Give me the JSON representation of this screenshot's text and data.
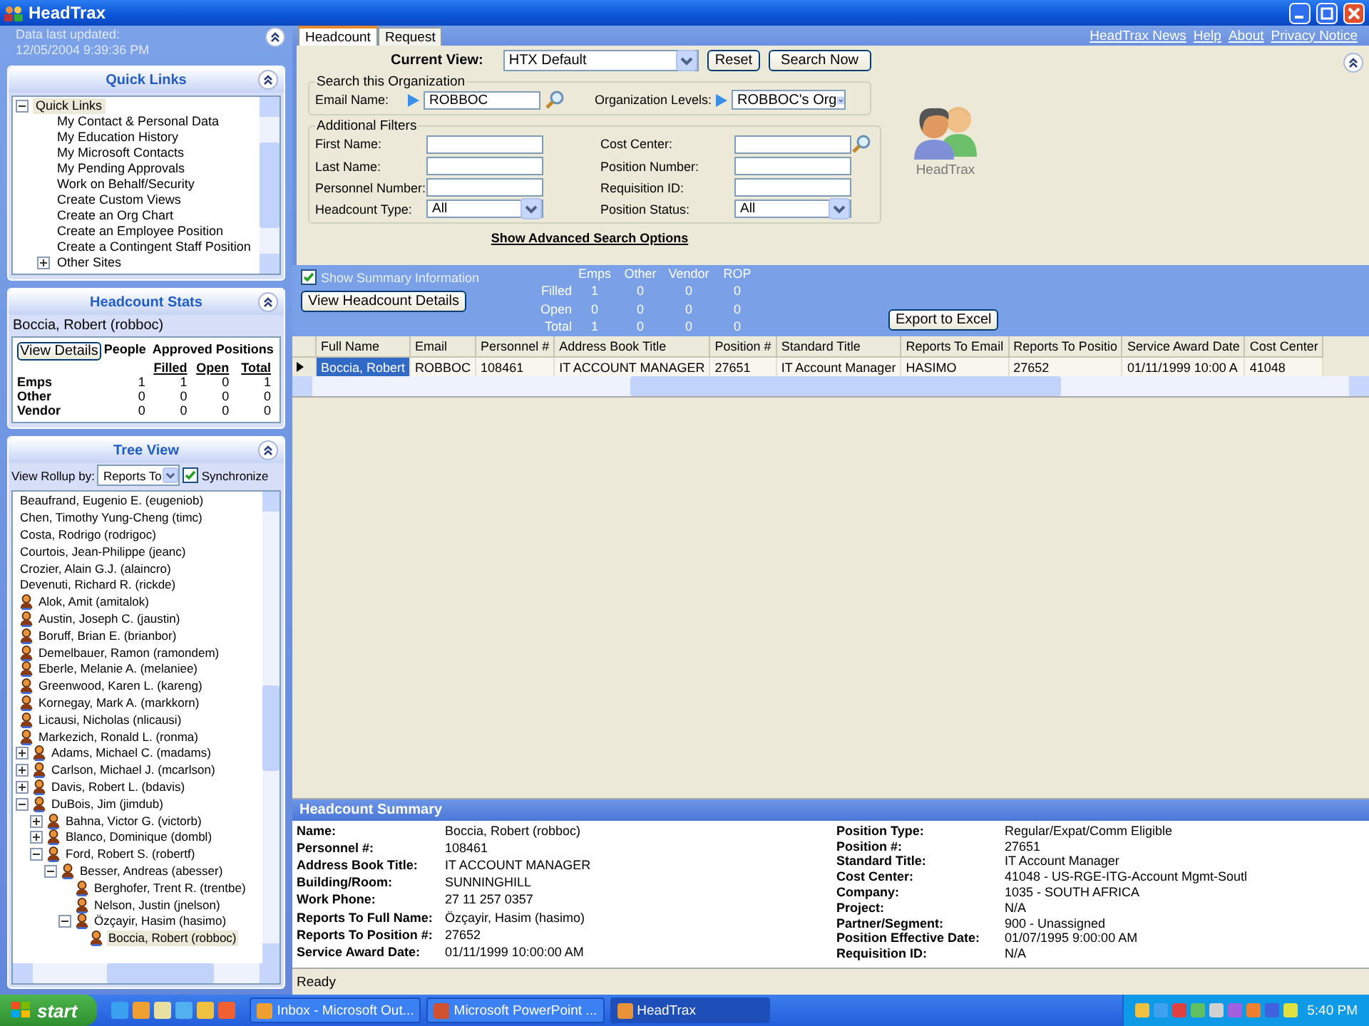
{
  "window": {
    "title": "HeadTrax"
  },
  "sidebar": {
    "updated_label": "Data last updated:",
    "updated_value": "12/05/2004 9:39:36 PM",
    "quick_links": {
      "title": "Quick Links",
      "items": [
        {
          "label": "Quick Links",
          "expanded": true,
          "selected": true,
          "children": [
            {
              "label": "My Contact & Personal Data",
              "selected": false
            },
            {
              "label": "My Education History",
              "selected": false
            },
            {
              "label": "My Microsoft Contacts",
              "selected": false
            },
            {
              "label": "My Pending Approvals",
              "selected": false
            },
            {
              "label": "Work on Behalf/Security",
              "selected": false
            },
            {
              "label": "Create Custom Views",
              "selected": false
            },
            {
              "label": "Create an Org Chart",
              "selected": false
            },
            {
              "label": "Create an Employee Position",
              "selected": false
            },
            {
              "label": "Create a Contingent Staff Position",
              "selected": false
            },
            {
              "label": "Other Sites",
              "expanded": false,
              "selected": false
            }
          ]
        }
      ]
    },
    "headcount_stats": {
      "title": "Headcount Stats",
      "person": "Boccia, Robert (robboc)",
      "button": "View Details",
      "people_header": "People",
      "positions_header": "Approved Positions",
      "columns": [
        "Filled",
        "Open",
        "Total"
      ],
      "rows": [
        {
          "label": "Emps",
          "people": "1",
          "values": [
            "1",
            "0",
            "1"
          ]
        },
        {
          "label": "Other",
          "people": "0",
          "values": [
            "0",
            "0",
            "0"
          ]
        },
        {
          "label": "Vendor",
          "people": "0",
          "values": [
            "0",
            "0",
            "0"
          ]
        }
      ]
    },
    "tree_view": {
      "title": "Tree View",
      "rollup_label": "View Rollup by:",
      "rollup_value": "Reports To",
      "synchronize": {
        "label": "Synchronize",
        "checked": true
      },
      "items": [
        {
          "label": "Beaufrand, Eugenio E. (eugeniob)",
          "kind": "plain",
          "selected": false
        },
        {
          "label": "Chen, Timothy Yung-Cheng (timc)",
          "kind": "plain",
          "selected": false
        },
        {
          "label": "Costa, Rodrigo (rodrigoc)",
          "kind": "plain",
          "selected": false
        },
        {
          "label": "Courtois, Jean-Philippe (jeanc)",
          "kind": "plain",
          "selected": false
        },
        {
          "label": "Crozier, Alain G.J. (alaincro)",
          "kind": "plain",
          "selected": false
        },
        {
          "label": "Devenuti, Richard R. (rickde)",
          "kind": "plain",
          "selected": false
        },
        {
          "label": "Alok, Amit (amitalok)",
          "kind": "person",
          "selected": false
        },
        {
          "label": "Austin, Joseph C. (jaustin)",
          "kind": "person",
          "selected": false
        },
        {
          "label": "Boruff, Brian E. (brianbor)",
          "kind": "person",
          "selected": false
        },
        {
          "label": "Demelbauer, Ramon (ramondem)",
          "kind": "person",
          "selected": false
        },
        {
          "label": "Eberle, Melanie A. (melaniee)",
          "kind": "person",
          "selected": false
        },
        {
          "label": "Greenwood, Karen L. (kareng)",
          "kind": "person",
          "selected": false
        },
        {
          "label": "Kornegay, Mark A. (markkorn)",
          "kind": "person",
          "selected": false
        },
        {
          "label": "Licausi, Nicholas (nlicausi)",
          "kind": "person",
          "selected": false
        },
        {
          "label": "Markezich, Ronald L. (ronma)",
          "kind": "person",
          "selected": false
        },
        {
          "label": "Adams, Michael C. (madams)",
          "kind": "person",
          "expanded": false,
          "selected": false
        },
        {
          "label": "Carlson, Michael J. (mcarlson)",
          "kind": "person",
          "expanded": false,
          "selected": false
        },
        {
          "label": "Davis, Robert L. (bdavis)",
          "kind": "person",
          "expanded": false,
          "selected": false
        },
        {
          "label": "DuBois, Jim (jimdub)",
          "kind": "person",
          "expanded": true,
          "selected": false,
          "children": [
            {
              "label": "Bahna, Victor G. (victorb)",
              "kind": "person",
              "expanded": false,
              "selected": false
            },
            {
              "label": "Blanco, Dominique (dombl)",
              "kind": "person",
              "expanded": false,
              "selected": false
            },
            {
              "label": "Ford, Robert S. (robertf)",
              "kind": "person",
              "expanded": true,
              "selected": false,
              "children": [
                {
                  "label": "Besser, Andreas (abesser)",
                  "kind": "person",
                  "expanded": true,
                  "selected": false,
                  "children": [
                    {
                      "label": "Berghofer, Trent R. (trentbe)",
                      "kind": "person",
                      "selected": false
                    },
                    {
                      "label": "Nelson, Justin (jnelson)",
                      "kind": "person",
                      "selected": false
                    },
                    {
                      "label": "Özçayir, Hasim (hasimo)",
                      "kind": "person",
                      "expanded": true,
                      "selected": false,
                      "children": [
                        {
                          "label": "Boccia, Robert (robboc)",
                          "kind": "person",
                          "selected": true
                        }
                      ]
                    }
                  ]
                }
              ]
            }
          ]
        }
      ]
    }
  },
  "tabs": [
    {
      "label": "Headcount",
      "selected": true
    },
    {
      "label": "Request",
      "selected": false
    }
  ],
  "top_links": [
    "HeadTrax News",
    "Help",
    "About",
    "Privacy Notice"
  ],
  "search": {
    "current_view_label": "Current View:",
    "current_view": "HTX Default",
    "buttons": [
      "Reset",
      "Search Now"
    ],
    "org_group": {
      "title": "Search this Organization",
      "email_label": "Email Name:",
      "email_value": "ROBBOC",
      "org_label": "Organization Levels:",
      "org_value": "ROBBOC's Org"
    },
    "filters": {
      "title": "Additional Filters",
      "fields": [
        {
          "label": "First Name:",
          "kind": "text"
        },
        {
          "label": "Cost Center:",
          "kind": "lookup"
        },
        {
          "label": "Last Name:",
          "kind": "text"
        },
        {
          "label": "Position Number:",
          "kind": "text"
        },
        {
          "label": "Personnel Number:",
          "kind": "text"
        },
        {
          "label": "Requisition ID:",
          "kind": "text"
        },
        {
          "label": "Headcount Type:",
          "kind": "select",
          "value": "All"
        },
        {
          "label": "Position Status:",
          "kind": "select",
          "value": "All"
        }
      ]
    },
    "advanced_link": "Show Advanced Search Options"
  },
  "logo_caption": "HeadTrax",
  "summary": {
    "show_summary": {
      "label": "Show Summary Information",
      "checked": true
    },
    "columns": [
      "Emps",
      "Other",
      "Vendor",
      "ROP"
    ],
    "rows": [
      {
        "label": "Filled",
        "values": [
          "1",
          "0",
          "0",
          "0"
        ]
      },
      {
        "label": "Open",
        "values": [
          "0",
          "0",
          "0",
          "0"
        ]
      },
      {
        "label": "Total",
        "values": [
          "1",
          "0",
          "0",
          "0"
        ]
      }
    ],
    "details_button": "View Headcount Details",
    "export_button": "Export to Excel"
  },
  "grid": {
    "columns": [
      "Full Name",
      "Email",
      "Personnel #",
      "Address Book Title",
      "Position #",
      "Standard Title",
      "Reports To Email",
      "Reports To Positio",
      "Service Award Date",
      "Cost Center"
    ],
    "rows": [
      {
        "selected": true,
        "cells": [
          "Boccia, Robert",
          "ROBBOC",
          "108461",
          "IT ACCOUNT MANAGER",
          "27651",
          "IT Account Manager",
          "HASIMO",
          "27652",
          "01/11/1999 10:00 A",
          "41048"
        ]
      }
    ]
  },
  "detail": {
    "title": "Headcount Summary",
    "left": [
      {
        "label": "Name:",
        "value": "Boccia, Robert (robboc)"
      },
      {
        "label": "Personnel #:",
        "value": "108461"
      },
      {
        "label": "Address Book Title:",
        "value": "IT ACCOUNT MANAGER"
      },
      {
        "label": "Building/Room:",
        "value": "SUNNINGHILL"
      },
      {
        "label": "Work Phone:",
        "value": "27 11 257 0357"
      },
      {
        "label": "Reports To Full Name:",
        "value": "Özçayir, Hasim (hasimo)"
      },
      {
        "label": "Reports To Position #:",
        "value": "27652"
      },
      {
        "label": "Service Award Date:",
        "value": "01/11/1999 10:00:00 AM"
      }
    ],
    "right": [
      {
        "label": "Position Type:",
        "value": "Regular/Expat/Comm Eligible"
      },
      {
        "label": "Position #:",
        "value": "27651"
      },
      {
        "label": "Standard Title:",
        "value": "IT Account Manager"
      },
      {
        "label": "Cost Center:",
        "value": "41048 - US-RGE-ITG-Account Mgmt-Soutl"
      },
      {
        "label": "Company:",
        "value": "1035 - SOUTH AFRICA"
      },
      {
        "label": "Project:",
        "value": "N/A"
      },
      {
        "label": "Partner/Segment:",
        "value": "900 - Unassigned"
      },
      {
        "label": "Position Effective Date:",
        "value": "01/07/1995 9:00:00 AM"
      },
      {
        "label": "Requisition ID:",
        "value": "N/A"
      }
    ]
  },
  "status_bar": "Ready",
  "taskbar": {
    "start": "start",
    "tasks": [
      {
        "label": "Inbox - Microsoft Out...",
        "selected": false
      },
      {
        "label": "Microsoft PowerPoint ...",
        "selected": false
      },
      {
        "label": "HeadTrax",
        "selected": true
      }
    ],
    "clock": "5:40 PM"
  }
}
